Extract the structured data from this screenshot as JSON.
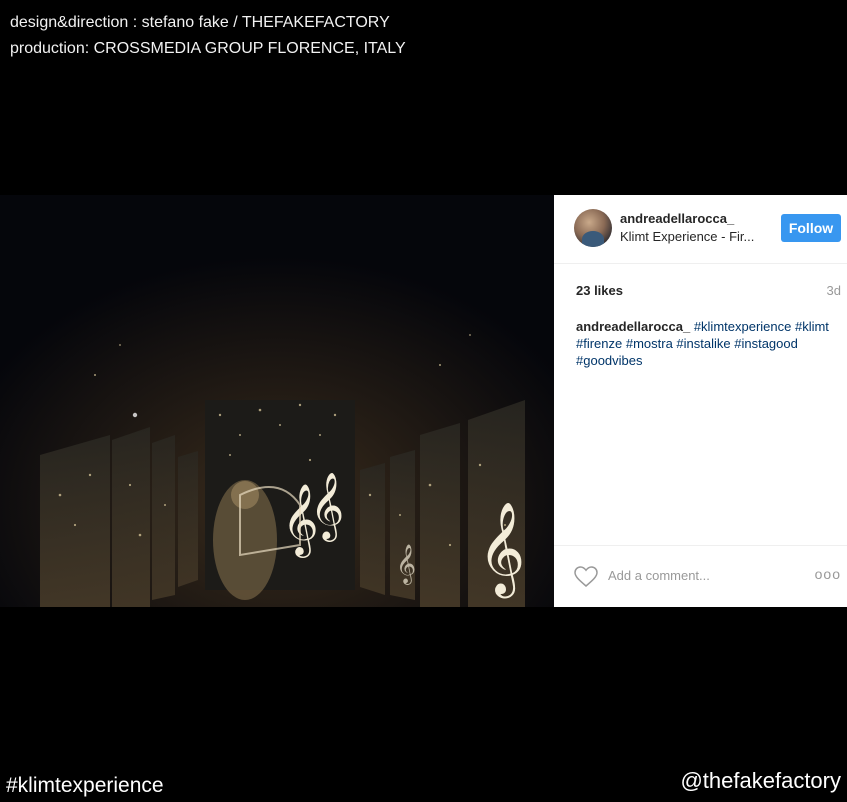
{
  "credits": {
    "line1": "design&direction : stefano fake / THEFAKEFACTORY",
    "line2": "production: CROSSMEDIA GROUP FLORENCE, ITALY"
  },
  "post": {
    "username": "andreadellarocca_",
    "location": "Klimt Experience - Fir...",
    "follow_label": "Follow",
    "likes": "23 likes",
    "age": "3d",
    "caption_user": "andreadellarocca_",
    "caption_tags": "#klimtexperience #klimt #firenze #mostra #instalike #instagood #goodvibes",
    "comment_placeholder": "Add a comment...",
    "more_label": "ooo",
    "icons": {
      "heart": "heart-icon",
      "more": "more-options-icon"
    },
    "colors": {
      "follow_button": "#3897f0",
      "hashtag_link": "#003569",
      "muted": "#999999"
    }
  },
  "footer": {
    "hashtag": "#klimtexperience",
    "handle": "@thefakefactory"
  }
}
